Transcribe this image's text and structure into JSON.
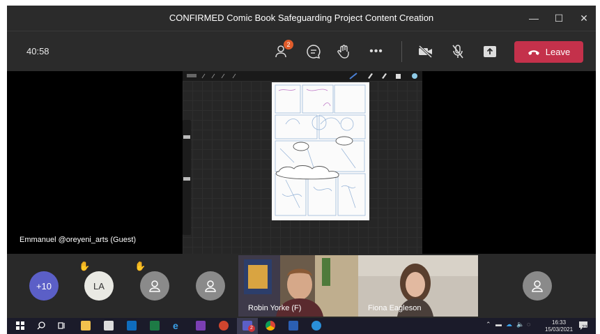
{
  "window": {
    "title": "CONFIRMED Comic Book Safeguarding Project Content Creation"
  },
  "controls": {
    "timer": "40:58",
    "participants_badge": "2",
    "leave_label": "Leave"
  },
  "main": {
    "guest_name": "Emmanuel @oreyeni_arts (Guest)"
  },
  "participants": {
    "overflow": "+10",
    "la_initials": "LA",
    "video1_name": "Robin Yorke (F)",
    "video2_name": "Fiona Eagleson"
  },
  "taskbar": {
    "time": "16:33",
    "date": "15/03/2021",
    "notifications": "23",
    "teams_badge": "2"
  },
  "colors": {
    "leave": "#c4314b",
    "overflow_avatar": "#5b5fc7",
    "badge": "#e05c2b"
  }
}
